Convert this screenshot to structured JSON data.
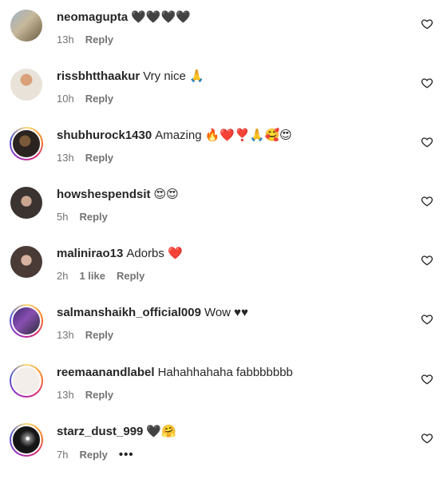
{
  "comments": [
    {
      "username": "neomagupta",
      "text": "🖤🖤🖤🖤",
      "time": "13h",
      "likes": "",
      "reply": "Reply",
      "more": "",
      "heart_icon": "heart-outline-icon"
    },
    {
      "username": "rissbhtthaakur",
      "text": "Vry nice 🙏",
      "time": "10h",
      "likes": "",
      "reply": "Reply",
      "more": "",
      "heart_icon": "heart-outline-icon"
    },
    {
      "username": "shubhurock1430",
      "text": "Amazing 🔥❤️❣️🙏🥰😍",
      "time": "13h",
      "likes": "",
      "reply": "Reply",
      "more": "",
      "heart_icon": "heart-outline-icon"
    },
    {
      "username": "howshespendsit",
      "text": "😍😍",
      "time": "5h",
      "likes": "",
      "reply": "Reply",
      "more": "",
      "heart_icon": "heart-outline-icon"
    },
    {
      "username": "malinirao13",
      "text": "Adorbs ❤️",
      "time": "2h",
      "likes": "1 like",
      "reply": "Reply",
      "more": "",
      "heart_icon": "heart-outline-icon"
    },
    {
      "username": "salmanshaikh_official009",
      "text": "Wow ♥♥",
      "time": "13h",
      "likes": "",
      "reply": "Reply",
      "more": "",
      "heart_icon": "heart-outline-icon"
    },
    {
      "username": "reemaanandlabel",
      "text": "Hahahhahaha fabbbbbbb",
      "time": "13h",
      "likes": "",
      "reply": "Reply",
      "more": "",
      "heart_icon": "heart-outline-icon"
    },
    {
      "username": "starz_dust_999",
      "text": "🖤🤗",
      "time": "7h",
      "likes": "",
      "reply": "Reply",
      "more": "•••",
      "heart_icon": "heart-outline-icon"
    }
  ]
}
